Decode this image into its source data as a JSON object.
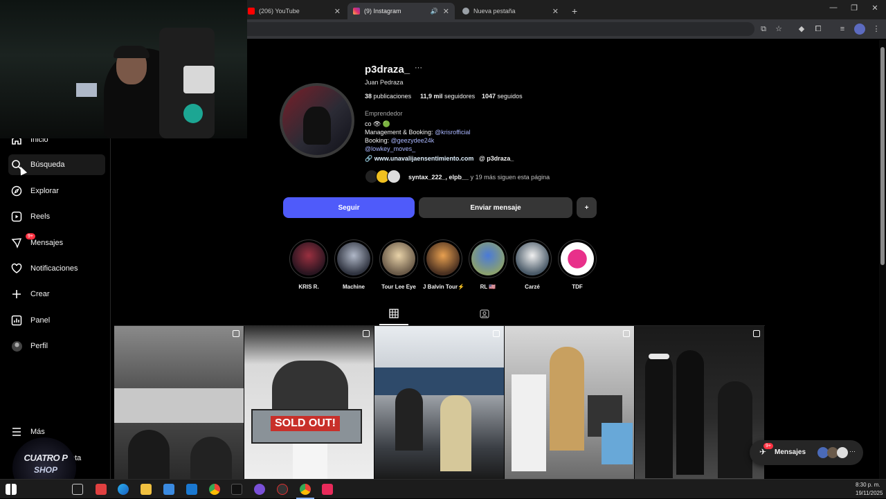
{
  "browser": {
    "tabs": [
      {
        "title": "(206) YouTube"
      },
      {
        "title": "(9) Instagram"
      },
      {
        "title": "Nueva pestaña"
      }
    ],
    "new_tab": "+"
  },
  "sidebar": {
    "items": [
      {
        "label": "Inicio"
      },
      {
        "label": "Búsqueda"
      },
      {
        "label": "Explorar"
      },
      {
        "label": "Reels"
      },
      {
        "label": "Mensajes",
        "badge": "9+"
      },
      {
        "label": "Notificaciones"
      },
      {
        "label": "Crear"
      },
      {
        "label": "Panel"
      },
      {
        "label": "Perfil"
      }
    ],
    "more": "Más",
    "bottom_partial": "eta"
  },
  "profile": {
    "username": "p3draza_",
    "more": "···",
    "full_name": "Juan Pedraza",
    "posts_count": "38",
    "posts_label": "publicaciones",
    "followers_count": "11,9 mil",
    "followers_label": "seguidores",
    "following_count": "1047",
    "following_label": "seguidos",
    "category": "Emprendedor",
    "bio_line1": "co 👁 🟢",
    "bio_mgmt_prefix": "Management & Booking: ",
    "bio_mgmt_link": "@krisrofficial",
    "bio_booking_prefix": "Booking: ",
    "bio_booking_link": "@geezydee24k",
    "bio_line4": "@lowkey_moves_",
    "website": "www.unavalijaensentimiento.com",
    "threads": "p3draza_",
    "followed_by_names": "syntax_222_, elpb__",
    "followed_by_rest": "y 19 más siguen esta página"
  },
  "actions": {
    "follow": "Seguir",
    "message": "Enviar mensaje",
    "suggest": "+"
  },
  "highlights": [
    {
      "label": "KRIS R."
    },
    {
      "label": "Machine"
    },
    {
      "label": "Tour Lee Eye"
    },
    {
      "label": "J Balvin Tour⚡"
    },
    {
      "label": "RL 🇺🇸"
    },
    {
      "label": "Carzé"
    },
    {
      "label": "TDF"
    }
  ],
  "posts_text": {
    "sold_out": "SOLD OUT!"
  },
  "messages_bar": {
    "label": "Mensajes",
    "badge": "9+",
    "more": "···"
  },
  "watermark": {
    "top": "CUATRO P",
    "bottom": "SHOP"
  },
  "taskbar": {
    "time": "8:30 p. m.",
    "date": "19/11/2025"
  },
  "colors": {
    "accent": "#4f5bfa",
    "link": "#aab7ff",
    "badge": "#ff3040",
    "button_secondary": "#363636"
  }
}
